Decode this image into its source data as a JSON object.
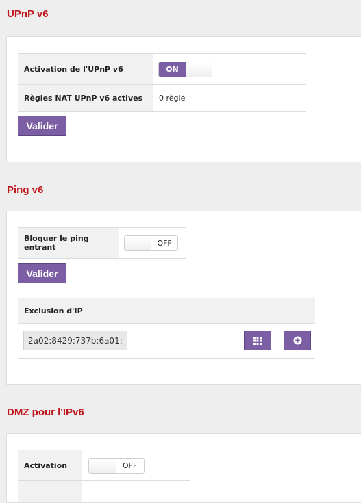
{
  "upnp": {
    "title": "UPnP v6",
    "activation_label": "Activation de l'UPnP v6",
    "activation_state": "ON",
    "rules_label": "Règles NAT UPnP v6 actives",
    "rules_value": "0 règle",
    "submit_label": "Valider"
  },
  "ping": {
    "title": "Ping v6",
    "block_label": "Bloquer le ping entrant",
    "block_state": "OFF",
    "submit_label": "Valider",
    "exclusion_header": "Exclusion d'IP",
    "ip_prefix": "2a02:8429:737b:6a01:",
    "ip_suffix_value": ""
  },
  "dmz": {
    "title": "DMZ pour l'IPv6",
    "activation_label": "Activation",
    "activation_state": "OFF"
  },
  "colors": {
    "accent": "#7b5ea3",
    "title_red": "#c0161b"
  }
}
